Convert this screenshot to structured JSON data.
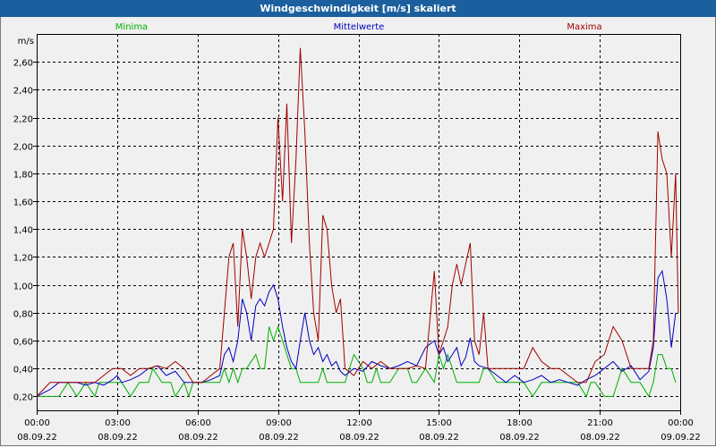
{
  "chart_data": {
    "type": "line",
    "title": "Windgeschwindigkeit [m/s] skaliert",
    "ylabel": "m/s",
    "ylim": [
      0.1,
      2.8
    ],
    "yticks": [
      0.2,
      0.4,
      0.6,
      0.8,
      1.0,
      1.2,
      1.4,
      1.6,
      1.8,
      2.0,
      2.2,
      2.4,
      2.6
    ],
    "ytick_labels": [
      "0,20",
      "0,40",
      "0,60",
      "0,80",
      "1,00",
      "1,20",
      "1,40",
      "1,60",
      "1,80",
      "2,00",
      "2,20",
      "2,40",
      "2,60"
    ],
    "x_start_hours": 0,
    "x_end_hours": 24,
    "xticks": [
      0,
      3,
      6,
      9,
      12,
      15,
      18,
      21,
      24
    ],
    "xtick_labels": [
      [
        "00:00",
        "08.09.22"
      ],
      [
        "03:00",
        "08.09.22"
      ],
      [
        "06:00",
        "08.09.22"
      ],
      [
        "09:00",
        "08.09.22"
      ],
      [
        "12:00",
        "08.09.22"
      ],
      [
        "15:00",
        "08.09.22"
      ],
      [
        "18:00",
        "08.09.22"
      ],
      [
        "21:00",
        "08.09.22"
      ],
      [
        "00:00",
        "09.09.22"
      ]
    ],
    "grid": true,
    "legend_position": "top",
    "series": [
      {
        "name": "Minima",
        "color": "#00b000",
        "x": [
          0,
          0.83,
          1.17,
          1.5,
          1.83,
          2.17,
          2.33,
          2.67,
          3.0,
          3.17,
          3.5,
          3.83,
          4.17,
          4.33,
          4.67,
          5.0,
          5.17,
          5.5,
          5.67,
          5.83,
          6.17,
          6.5,
          6.83,
          7.0,
          7.17,
          7.33,
          7.5,
          7.67,
          7.83,
          8.17,
          8.33,
          8.5,
          8.67,
          8.83,
          9.0,
          9.17,
          9.33,
          9.5,
          9.67,
          9.83,
          10.17,
          10.5,
          10.67,
          10.83,
          11.17,
          11.5,
          11.83,
          12.17,
          12.33,
          12.5,
          12.67,
          12.83,
          13.17,
          13.5,
          13.83,
          14.0,
          14.17,
          14.5,
          14.83,
          15.0,
          15.17,
          15.33,
          15.5,
          15.67,
          15.83,
          16.0,
          16.17,
          16.33,
          16.5,
          16.67,
          16.83,
          17.17,
          17.5,
          17.83,
          18.17,
          18.5,
          18.83,
          19.17,
          19.5,
          19.83,
          20.17,
          20.5,
          20.67,
          20.83,
          21.17,
          21.5,
          21.83,
          22.17,
          22.5,
          22.83,
          23.0,
          23.17,
          23.33,
          23.5,
          23.67,
          23.83
        ],
        "values": [
          0.2,
          0.2,
          0.3,
          0.2,
          0.3,
          0.2,
          0.3,
          0.3,
          0.3,
          0.3,
          0.2,
          0.3,
          0.3,
          0.4,
          0.3,
          0.3,
          0.2,
          0.3,
          0.2,
          0.3,
          0.3,
          0.3,
          0.3,
          0.4,
          0.3,
          0.4,
          0.3,
          0.4,
          0.4,
          0.5,
          0.4,
          0.4,
          0.7,
          0.6,
          0.7,
          0.6,
          0.5,
          0.4,
          0.4,
          0.3,
          0.3,
          0.3,
          0.4,
          0.3,
          0.3,
          0.3,
          0.5,
          0.4,
          0.3,
          0.3,
          0.4,
          0.3,
          0.3,
          0.4,
          0.4,
          0.3,
          0.3,
          0.4,
          0.3,
          0.5,
          0.4,
          0.5,
          0.4,
          0.3,
          0.3,
          0.3,
          0.3,
          0.3,
          0.3,
          0.4,
          0.4,
          0.3,
          0.3,
          0.3,
          0.3,
          0.2,
          0.3,
          0.3,
          0.3,
          0.3,
          0.3,
          0.2,
          0.3,
          0.3,
          0.2,
          0.2,
          0.4,
          0.3,
          0.3,
          0.2,
          0.3,
          0.5,
          0.5,
          0.4,
          0.4,
          0.3
        ]
      },
      {
        "name": "Mittelwerte",
        "color": "#0000c0",
        "x": [
          0,
          0.5,
          0.83,
          1.17,
          1.5,
          1.83,
          2.17,
          2.5,
          2.83,
          3.0,
          3.17,
          3.5,
          3.83,
          4.17,
          4.5,
          4.83,
          5.17,
          5.5,
          5.83,
          6.17,
          6.5,
          6.83,
          7.0,
          7.17,
          7.33,
          7.5,
          7.67,
          7.83,
          8.0,
          8.17,
          8.33,
          8.5,
          8.67,
          8.83,
          9.0,
          9.17,
          9.33,
          9.5,
          9.67,
          9.83,
          10.0,
          10.17,
          10.33,
          10.5,
          10.67,
          10.83,
          11.0,
          11.17,
          11.33,
          11.5,
          11.83,
          12.17,
          12.5,
          12.83,
          13.17,
          13.5,
          13.83,
          14.17,
          14.5,
          14.83,
          15.0,
          15.17,
          15.33,
          15.5,
          15.67,
          15.83,
          16.0,
          16.17,
          16.33,
          16.5,
          16.83,
          17.17,
          17.5,
          17.83,
          18.17,
          18.5,
          18.83,
          19.17,
          19.5,
          19.83,
          20.17,
          20.5,
          20.83,
          21.17,
          21.5,
          21.83,
          22.17,
          22.5,
          22.83,
          23.0,
          23.17,
          23.33,
          23.5,
          23.67,
          23.83
        ],
        "values": [
          0.2,
          0.25,
          0.3,
          0.3,
          0.3,
          0.28,
          0.3,
          0.28,
          0.32,
          0.35,
          0.3,
          0.32,
          0.35,
          0.4,
          0.42,
          0.35,
          0.38,
          0.3,
          0.3,
          0.3,
          0.32,
          0.35,
          0.5,
          0.55,
          0.45,
          0.6,
          0.9,
          0.8,
          0.6,
          0.85,
          0.9,
          0.85,
          0.95,
          1.0,
          0.9,
          0.7,
          0.55,
          0.45,
          0.4,
          0.6,
          0.8,
          0.6,
          0.5,
          0.55,
          0.45,
          0.5,
          0.42,
          0.45,
          0.38,
          0.35,
          0.4,
          0.38,
          0.45,
          0.42,
          0.4,
          0.42,
          0.45,
          0.42,
          0.55,
          0.6,
          0.5,
          0.55,
          0.45,
          0.5,
          0.55,
          0.42,
          0.48,
          0.62,
          0.45,
          0.42,
          0.4,
          0.35,
          0.3,
          0.35,
          0.3,
          0.32,
          0.35,
          0.3,
          0.32,
          0.3,
          0.28,
          0.32,
          0.35,
          0.4,
          0.45,
          0.38,
          0.42,
          0.32,
          0.38,
          0.55,
          1.05,
          1.1,
          0.9,
          0.55,
          0.8
        ]
      },
      {
        "name": "Maxima",
        "color": "#a00000",
        "x": [
          0,
          0.5,
          0.83,
          1.17,
          1.5,
          1.83,
          2.17,
          2.5,
          2.83,
          3.17,
          3.5,
          3.83,
          4.17,
          4.5,
          4.83,
          5.17,
          5.5,
          5.83,
          6.17,
          6.5,
          6.83,
          7.0,
          7.17,
          7.33,
          7.5,
          7.67,
          7.83,
          8.0,
          8.17,
          8.33,
          8.5,
          8.67,
          8.83,
          9.0,
          9.17,
          9.33,
          9.5,
          9.67,
          9.83,
          10.0,
          10.17,
          10.33,
          10.5,
          10.67,
          10.83,
          11.0,
          11.17,
          11.33,
          11.5,
          11.83,
          12.17,
          12.5,
          12.83,
          13.17,
          13.5,
          13.83,
          14.17,
          14.5,
          14.83,
          15.0,
          15.17,
          15.33,
          15.5,
          15.67,
          15.83,
          16.0,
          16.17,
          16.33,
          16.5,
          16.67,
          16.83,
          17.17,
          17.5,
          17.83,
          18.17,
          18.5,
          18.83,
          19.17,
          19.5,
          19.83,
          20.17,
          20.5,
          20.83,
          21.17,
          21.5,
          21.83,
          22.17,
          22.5,
          22.83,
          23.0,
          23.17,
          23.33,
          23.5,
          23.67,
          23.83,
          23.93
        ],
        "values": [
          0.2,
          0.3,
          0.3,
          0.3,
          0.3,
          0.3,
          0.3,
          0.35,
          0.4,
          0.4,
          0.35,
          0.4,
          0.4,
          0.42,
          0.4,
          0.45,
          0.4,
          0.3,
          0.3,
          0.35,
          0.4,
          0.8,
          1.2,
          1.3,
          0.7,
          1.4,
          1.2,
          0.9,
          1.2,
          1.3,
          1.2,
          1.3,
          1.4,
          2.2,
          1.6,
          2.3,
          1.3,
          1.9,
          2.7,
          2.1,
          1.3,
          0.8,
          0.6,
          1.5,
          1.4,
          1.0,
          0.8,
          0.9,
          0.4,
          0.35,
          0.45,
          0.4,
          0.45,
          0.4,
          0.4,
          0.4,
          0.42,
          0.4,
          1.1,
          0.5,
          0.6,
          0.7,
          1.0,
          1.15,
          1.0,
          1.15,
          1.3,
          0.6,
          0.5,
          0.8,
          0.4,
          0.4,
          0.4,
          0.4,
          0.4,
          0.55,
          0.45,
          0.4,
          0.4,
          0.35,
          0.3,
          0.3,
          0.45,
          0.5,
          0.7,
          0.6,
          0.4,
          0.4,
          0.4,
          0.6,
          2.1,
          1.9,
          1.8,
          1.2,
          1.8,
          0.8
        ]
      }
    ]
  }
}
